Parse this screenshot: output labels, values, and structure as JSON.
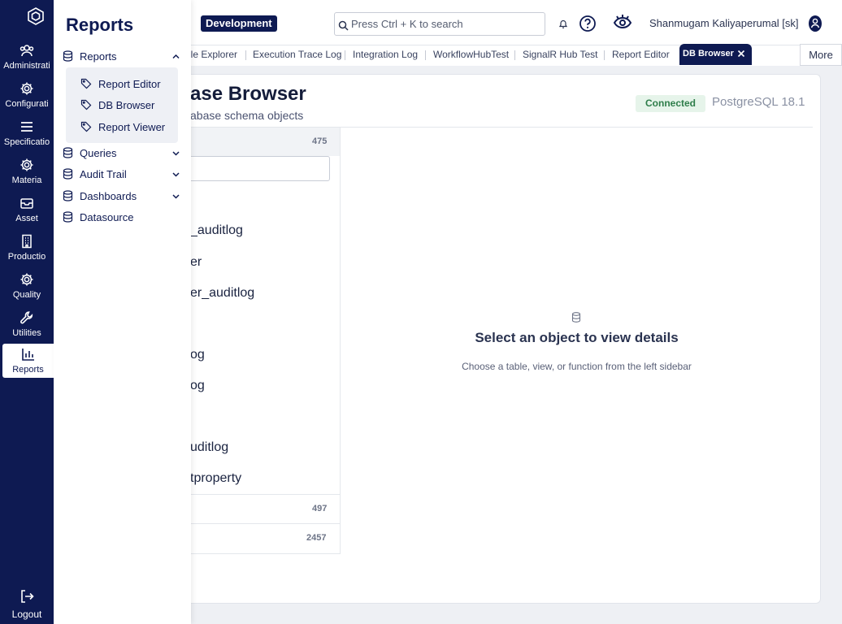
{
  "rail": {
    "items": [
      {
        "label": "Administrati",
        "icon": "users-icon"
      },
      {
        "label": "Configurati",
        "icon": "gear-icon"
      },
      {
        "label": "Specificatio",
        "icon": "list-icon"
      },
      {
        "label": "Materia",
        "icon": "gear-icon"
      },
      {
        "label": "Asset",
        "icon": "inbox-icon"
      },
      {
        "label": "Productio",
        "icon": "building-icon"
      },
      {
        "label": "Quality",
        "icon": "gear-icon"
      },
      {
        "label": "Utilities",
        "icon": "wrench-icon"
      },
      {
        "label": "Reports",
        "icon": "bar-chart-icon"
      }
    ],
    "logout_label": "Logout"
  },
  "topbar": {
    "env_badge": "Development",
    "search_placeholder": "Press Ctrl + K to search",
    "user_name": "Shanmugam Kaliyaperumal [sk]"
  },
  "tabs": {
    "items": [
      "ile Explorer",
      "Execution Trace Log",
      "Integration Log",
      "WorkflowHubTest",
      "SignalR Hub Test",
      "Report Editor"
    ],
    "active": "DB Browser",
    "more_label": "More"
  },
  "page": {
    "title": "ase Browser",
    "subtitle": "abase schema objects",
    "status": "Connected",
    "db_version": "PostgreSQL 18.1"
  },
  "left_panel": {
    "head_count": "475",
    "objects": [
      "_auditlog",
      "er",
      "er_auditlog",
      "og",
      "og",
      "uditlog",
      "tproperty"
    ],
    "groups": [
      {
        "count": "497"
      },
      {
        "count": "2457"
      }
    ]
  },
  "detail": {
    "empty_title": "Select an object to view details",
    "empty_sub": "Choose a table, view, or function from the left sidebar"
  },
  "flyout": {
    "title": "Reports",
    "sections": [
      {
        "label": "Reports",
        "expanded": true
      },
      {
        "label": "Queries"
      },
      {
        "label": "Audit Trail"
      },
      {
        "label": "Dashboards"
      },
      {
        "label": "Datasource"
      }
    ],
    "sub_items": [
      "Report Editor",
      "DB Browser",
      "Report Viewer"
    ]
  },
  "colors": {
    "brand": "#0e1a52",
    "connected_bg": "#e6f4ea",
    "connected_fg": "#2e7d4a"
  }
}
